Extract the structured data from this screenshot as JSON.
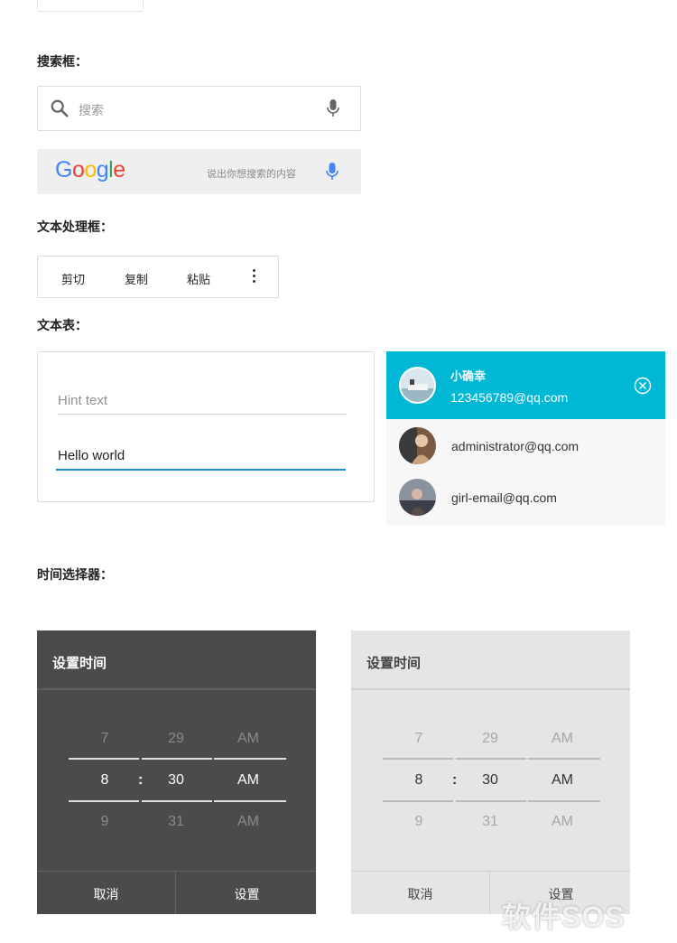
{
  "sections": {
    "search": "搜索框：",
    "text_toolbar": "文本处理框：",
    "text_form": "文本表：",
    "time_picker": "时间选择器："
  },
  "search_box_1": {
    "placeholder": "搜索"
  },
  "search_box_2": {
    "placeholder": "说出你想搜索的内容"
  },
  "google_logo": {
    "letters": [
      "G",
      "o",
      "o",
      "g",
      "l",
      "e"
    ],
    "colors": [
      "#4285F4",
      "#EA4335",
      "#FBBC05",
      "#4285F4",
      "#34A853",
      "#EA4335"
    ]
  },
  "text_toolbar": {
    "cut": "剪切",
    "copy": "复制",
    "paste": "粘贴"
  },
  "text_form": {
    "hint": "Hint text",
    "value": "Hello world",
    "accent": "#1b8ad1"
  },
  "accounts": {
    "accent": "#00b7d6",
    "selected": {
      "name": "小确幸",
      "email": "123456789@qq.com"
    },
    "others": [
      {
        "email": "administrator@qq.com"
      },
      {
        "email": "girl-email@qq.com"
      }
    ]
  },
  "time_pickers": [
    {
      "theme": "dark",
      "title": "设置时间",
      "hour": {
        "prev": "7",
        "cur": "8",
        "next": "9"
      },
      "minute": {
        "prev": "29",
        "cur": "30",
        "next": "31"
      },
      "ampm": {
        "prev": "AM",
        "cur": "AM",
        "next": "AM"
      },
      "separator": ":",
      "cancel": "取消",
      "set": "设置"
    },
    {
      "theme": "light",
      "title": "设置时间",
      "hour": {
        "prev": "7",
        "cur": "8",
        "next": "9"
      },
      "minute": {
        "prev": "29",
        "cur": "30",
        "next": "31"
      },
      "ampm": {
        "prev": "AM",
        "cur": "AM",
        "next": "AM"
      },
      "separator": ":",
      "cancel": "取消",
      "set": "设置"
    }
  ],
  "watermark": "软件SOS"
}
